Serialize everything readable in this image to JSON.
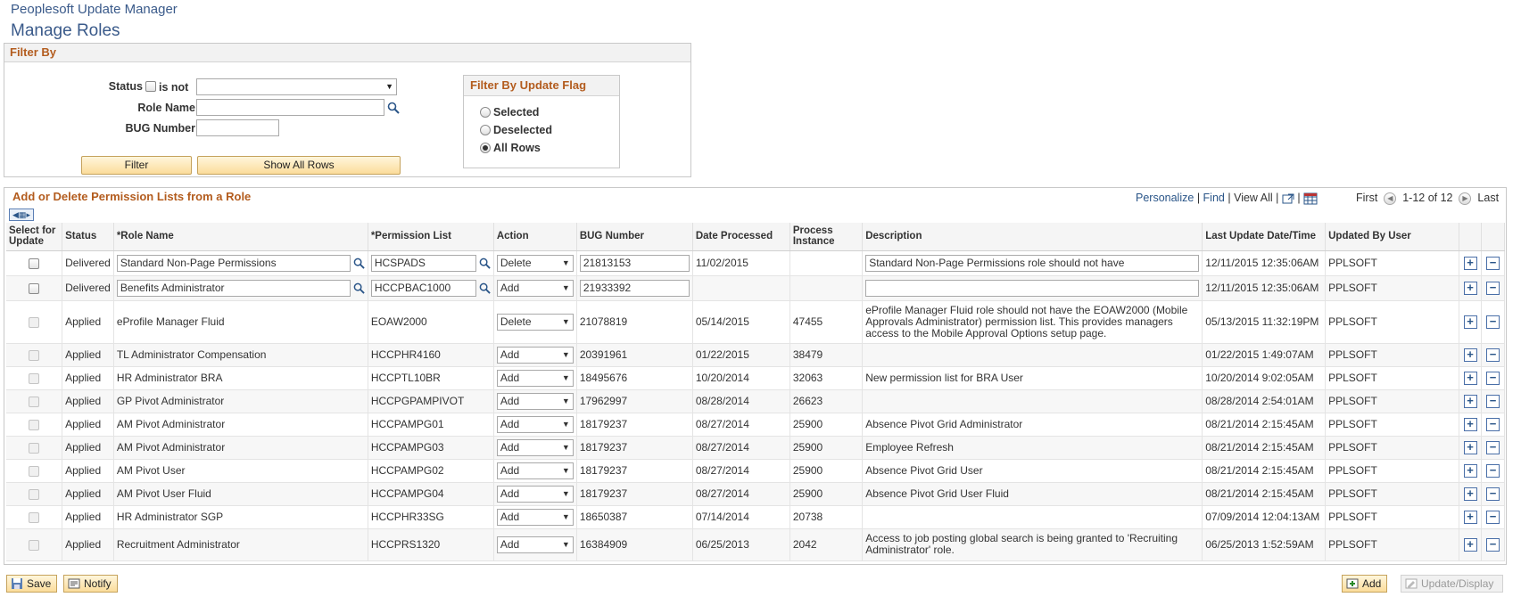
{
  "header": {
    "app_title": "Peoplesoft Update Manager",
    "page_title": "Manage Roles"
  },
  "filter": {
    "title": "Filter By",
    "status_label": "Status",
    "is_not_label": "is not",
    "status_value": "",
    "role_name_label": "Role Name",
    "role_name_value": "",
    "bug_number_label": "BUG Number",
    "bug_number_value": "",
    "filter_button": "Filter",
    "show_all_button": "Show All Rows",
    "flag_title": "Filter By Update Flag",
    "flag_options": [
      "Selected",
      "Deselected",
      "All Rows"
    ],
    "flag_selected": "All Rows"
  },
  "grid": {
    "title": "Add or Delete Permission Lists from a Role",
    "personalize": "Personalize",
    "find": "Find",
    "view_all": "View All",
    "first": "First",
    "range": "1-12 of 12",
    "last": "Last",
    "columns": [
      "Select for Update",
      "Status",
      "*Role Name",
      "*Permission List",
      "Action",
      "BUG Number",
      "Date Processed",
      "Process Instance",
      "Description",
      "Last Update Date/Time",
      "Updated By User"
    ],
    "rows": [
      {
        "status": "Delivered",
        "role": "Standard Non-Page Permissions",
        "perm": "HCSPADS",
        "action": "Delete",
        "bug": "21813153",
        "date": "11/02/2015",
        "instance": "",
        "desc": "Standard Non-Page Permissions role should not have",
        "updated": "12/11/2015 12:35:06AM",
        "user": "PPLSOFT",
        "editable": true
      },
      {
        "status": "Delivered",
        "role": "Benefits Administrator",
        "perm": "HCCPBAC1000",
        "action": "Add",
        "bug": "21933392",
        "date": "",
        "instance": "",
        "desc": "",
        "updated": "12/11/2015 12:35:06AM",
        "user": "PPLSOFT",
        "editable": true
      },
      {
        "status": "Applied",
        "role": "eProfile Manager Fluid",
        "perm": "EOAW2000",
        "action": "Delete",
        "bug": "21078819",
        "date": "05/14/2015",
        "instance": "47455",
        "desc": "eProfile Manager Fluid role should not have the EOAW2000 (Mobile Approvals Administrator) permission list. This provides managers access to the Mobile Approval Options setup page.",
        "updated": "05/13/2015 11:32:19PM",
        "user": "PPLSOFT",
        "editable": false
      },
      {
        "status": "Applied",
        "role": "TL Administrator Compensation",
        "perm": "HCCPHR4160",
        "action": "Add",
        "bug": "20391961",
        "date": "01/22/2015",
        "instance": "38479",
        "desc": "",
        "updated": "01/22/2015 1:49:07AM",
        "user": "PPLSOFT",
        "editable": false
      },
      {
        "status": "Applied",
        "role": "HR Administrator BRA",
        "perm": "HCCPTL10BR",
        "action": "Add",
        "bug": "18495676",
        "date": "10/20/2014",
        "instance": "32063",
        "desc": "New permission list for BRA User",
        "updated": "10/20/2014 9:02:05AM",
        "user": "PPLSOFT",
        "editable": false
      },
      {
        "status": "Applied",
        "role": "GP Pivot Administrator",
        "perm": "HCCPGPAMPIVOT",
        "action": "Add",
        "bug": "17962997",
        "date": "08/28/2014",
        "instance": "26623",
        "desc": "",
        "updated": "08/28/2014 2:54:01AM",
        "user": "PPLSOFT",
        "editable": false
      },
      {
        "status": "Applied",
        "role": "AM Pivot Administrator",
        "perm": "HCCPAMPG01",
        "action": "Add",
        "bug": "18179237",
        "date": "08/27/2014",
        "instance": "25900",
        "desc": "Absence Pivot Grid Administrator",
        "updated": "08/21/2014 2:15:45AM",
        "user": "PPLSOFT",
        "editable": false
      },
      {
        "status": "Applied",
        "role": "AM Pivot Administrator",
        "perm": "HCCPAMPG03",
        "action": "Add",
        "bug": "18179237",
        "date": "08/27/2014",
        "instance": "25900",
        "desc": "Employee Refresh",
        "updated": "08/21/2014 2:15:45AM",
        "user": "PPLSOFT",
        "editable": false
      },
      {
        "status": "Applied",
        "role": "AM Pivot User",
        "perm": "HCCPAMPG02",
        "action": "Add",
        "bug": "18179237",
        "date": "08/27/2014",
        "instance": "25900",
        "desc": "Absence Pivot Grid User",
        "updated": "08/21/2014 2:15:45AM",
        "user": "PPLSOFT",
        "editable": false
      },
      {
        "status": "Applied",
        "role": "AM Pivot User Fluid",
        "perm": "HCCPAMPG04",
        "action": "Add",
        "bug": "18179237",
        "date": "08/27/2014",
        "instance": "25900",
        "desc": "Absence Pivot Grid User Fluid",
        "updated": "08/21/2014 2:15:45AM",
        "user": "PPLSOFT",
        "editable": false
      },
      {
        "status": "Applied",
        "role": "HR Administrator SGP",
        "perm": "HCCPHR33SG",
        "action": "Add",
        "bug": "18650387",
        "date": "07/14/2014",
        "instance": "20738",
        "desc": "",
        "updated": "07/09/2014 12:04:13AM",
        "user": "PPLSOFT",
        "editable": false
      },
      {
        "status": "Applied",
        "role": "Recruitment Administrator",
        "perm": "HCCPRS1320",
        "action": "Add",
        "bug": "16384909",
        "date": "06/25/2013",
        "instance": "2042",
        "desc": "Access to job posting global search is being granted to 'Recruiting Administrator' role.",
        "updated": "06/25/2013 1:52:59AM",
        "user": "PPLSOFT",
        "editable": false
      }
    ]
  },
  "footer": {
    "save": "Save",
    "notify": "Notify",
    "add": "Add",
    "update_display": "Update/Display"
  },
  "colors": {
    "title_blue": "#3a5a8a",
    "section_orange": "#b35c1e",
    "button_gold": "#fbdc9a"
  }
}
